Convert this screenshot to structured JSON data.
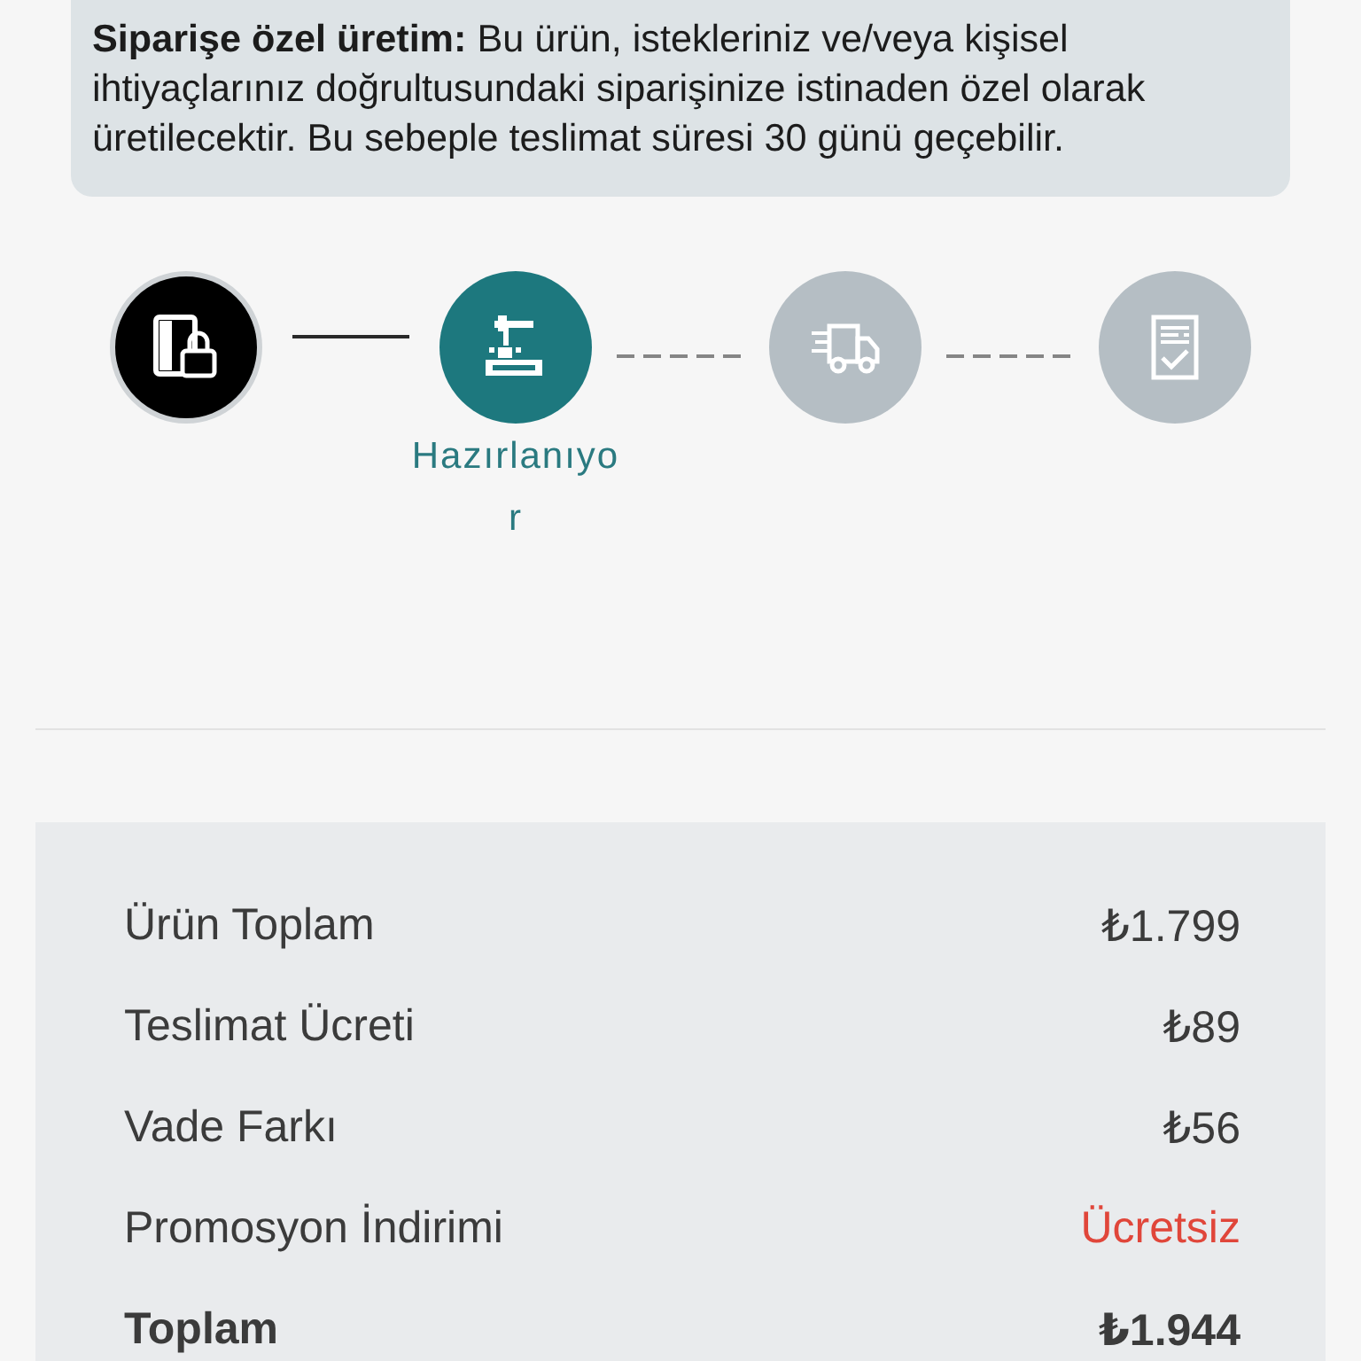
{
  "notice": {
    "text": "**Siparişe özel üretim:** Bu ürün, istekleriniz ve/veya kişisel ihtiyaçlarınız doğrultusundaki siparişinize istinaden özel olarak üretilecektir. Bu sebeple teslimat süresi 30 günü geçebilir."
  },
  "steps": [
    {
      "done": true,
      "selected": false
    },
    {
      "done": false,
      "selected": true,
      "label": "Hazırlanıyor"
    },
    {
      "done": false,
      "selected": false
    },
    {
      "done": false,
      "selected": false
    }
  ],
  "summary": {
    "rows": [
      {
        "kind": "normal",
        "label": "Ürün Toplam",
        "value": "₺1.799"
      },
      {
        "kind": "normal",
        "label": "Teslimat Ücreti",
        "value": "₺89"
      },
      {
        "kind": "normal",
        "label": "Vade Farkı",
        "value": "₺56"
      },
      {
        "kind": "discount",
        "label": "Promosyon İndirimi",
        "value": "Ücretsiz"
      },
      {
        "kind": "total",
        "label": "Toplam",
        "value": "₺1.944"
      }
    ]
  }
}
